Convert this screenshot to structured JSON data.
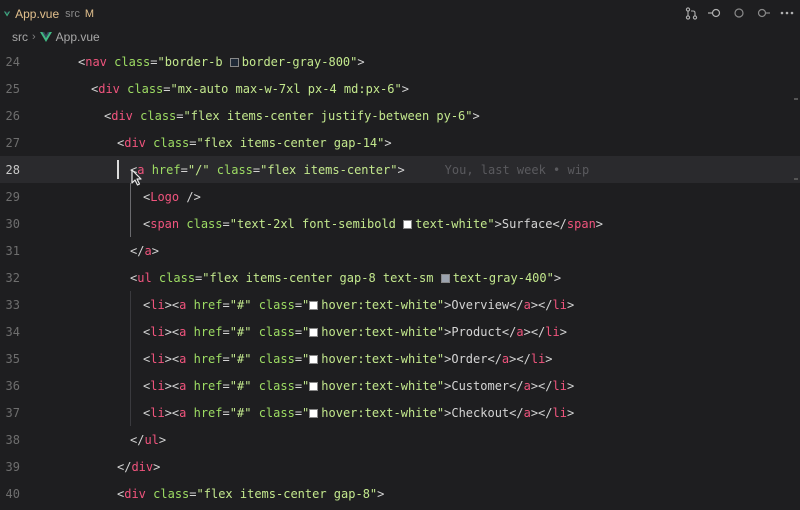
{
  "tab": {
    "filename": "App.vue",
    "dir": "src",
    "status": "M"
  },
  "breadcrumb": {
    "folder": "src",
    "file": "App.vue"
  },
  "lines": [
    {
      "n": "24"
    },
    {
      "n": "25"
    },
    {
      "n": "26"
    },
    {
      "n": "27"
    },
    {
      "n": "28"
    },
    {
      "n": "29"
    },
    {
      "n": "30"
    },
    {
      "n": "31"
    },
    {
      "n": "32"
    },
    {
      "n": "33"
    },
    {
      "n": "34"
    },
    {
      "n": "35"
    },
    {
      "n": "36"
    },
    {
      "n": "37"
    },
    {
      "n": "38"
    },
    {
      "n": "39"
    },
    {
      "n": "40"
    }
  ],
  "code": {
    "l24": {
      "tag": "nav",
      "attr": "class",
      "v1": "border-b ",
      "v2": "border-gray-800"
    },
    "l25": {
      "tag": "div",
      "attr": "class",
      "v": "mx-auto max-w-7xl px-4 md:px-6"
    },
    "l26": {
      "tag": "div",
      "attr": "class",
      "v": "flex items-center justify-between py-6"
    },
    "l27": {
      "tag": "div",
      "attr": "class",
      "v": "flex items-center gap-14"
    },
    "l28": {
      "tag": "a",
      "attr1": "href",
      "v1": "/",
      "attr2": "class",
      "v2": "flex items-center",
      "blame": "You, last week • wip"
    },
    "l29": {
      "tag": "Logo"
    },
    "l30": {
      "tag": "span",
      "attr": "class",
      "v1": "text-2xl font-semibold ",
      "v2": "text-white",
      "text": "Surface"
    },
    "l31": {
      "tag": "a"
    },
    "l32": {
      "tag": "ul",
      "attr": "class",
      "v1": "flex items-center gap-8 text-sm ",
      "v2": "text-gray-400"
    },
    "items": [
      {
        "href": "#",
        "cls": "hover:text-white",
        "text": "Overview"
      },
      {
        "href": "#",
        "cls": "hover:text-white",
        "text": "Product"
      },
      {
        "href": "#",
        "cls": "hover:text-white",
        "text": "Order"
      },
      {
        "href": "#",
        "cls": "hover:text-white",
        "text": "Customer"
      },
      {
        "href": "#",
        "cls": "hover:text-white",
        "text": "Checkout"
      }
    ],
    "l38": {
      "tag": "ul"
    },
    "l39": {
      "tag": "div"
    },
    "l40": {
      "tag": "div",
      "attr": "class",
      "v": "flex items-center gap-8"
    }
  },
  "colors": {
    "tag": "#f0547d",
    "attr": "#9ddc63",
    "string": "#c3e88d",
    "swatch_gray800": "#1f2937",
    "swatch_white": "#ffffff",
    "swatch_gray400": "#9ca3af"
  },
  "icons": [
    "vue-icon",
    "source-control-icon",
    "timeline-icon",
    "circle-icon",
    "go-forward-icon",
    "more-icon",
    "breadcrumb-chevron-icon",
    "mouse-pointer-icon"
  ]
}
